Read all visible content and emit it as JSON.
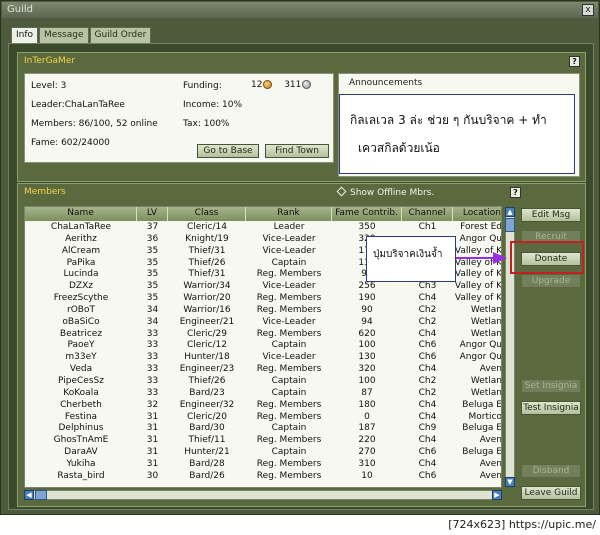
{
  "window": {
    "title": "Guild",
    "close_label": "x"
  },
  "tabs": [
    {
      "label": "Info"
    },
    {
      "label": "Message"
    },
    {
      "label": "Guild Order"
    }
  ],
  "guild": {
    "name": "InTerGaMer",
    "help_label": "?",
    "level": "Level: 3",
    "leader": "Leader:ChaLanTaRee",
    "members": "Members: 86/100, 52 online",
    "fame": "Fame: 602/24000",
    "funding_label": "Funding:",
    "funding_gold": "12",
    "funding_silver": "311",
    "income": "Income: 10%",
    "tax": "Tax: 100%",
    "go_to_base": "Go to Base",
    "find_town": "Find Town"
  },
  "announcements": {
    "title": "Announcements",
    "note_line1": "กิลเลเวล 3 ล่ะ ช่วย ๆ กันบริจาค + ทำ",
    "note_line2": "เควสกิลด้วยเน้อ"
  },
  "members_panel": {
    "title": "Members",
    "show_offline": "Show Offline Mbrs.",
    "help_label": "?",
    "columns": [
      "Name",
      "LV",
      "Class",
      "Rank",
      "Fame Contrib.",
      "Channel",
      "Location"
    ],
    "rows": [
      [
        "ChaLanTaRee",
        "37",
        "Cleric/14",
        "Leader",
        "350",
        "Ch1",
        "Forest Ed"
      ],
      [
        "Aerithz",
        "36",
        "Knight/19",
        "Vice-Leader",
        "320",
        "",
        "Angor Qu"
      ],
      [
        "AlCream",
        "35",
        "Thief/31",
        "Vice-Leader",
        "170",
        "",
        "Valley of K"
      ],
      [
        "PaPika",
        "35",
        "Thief/26",
        "Captain",
        "136",
        "",
        "Valley of K"
      ],
      [
        "Lucinda",
        "35",
        "Thief/31",
        "Reg. Members",
        "98",
        "",
        "Valley of K"
      ],
      [
        "DZXz",
        "35",
        "Warrior/34",
        "Vice-Leader",
        "256",
        "Ch3",
        "Valley of K"
      ],
      [
        "FreezScythe",
        "35",
        "Warrior/20",
        "Reg. Members",
        "190",
        "Ch4",
        "Valley of K"
      ],
      [
        "rOBoT",
        "34",
        "Warrior/16",
        "Reg. Members",
        "90",
        "Ch2",
        "Wetlan"
      ],
      [
        "oBaSiCo",
        "34",
        "Engineer/21",
        "Vice-Leader",
        "94",
        "Ch2",
        "Wetlan"
      ],
      [
        "Beatricez",
        "33",
        "Cleric/29",
        "Reg. Members",
        "620",
        "Ch4",
        "Wetlan"
      ],
      [
        "PaoeY",
        "33",
        "Cleric/12",
        "Captain",
        "100",
        "Ch6",
        "Angor Qu"
      ],
      [
        "m33eY",
        "33",
        "Hunter/18",
        "Vice-Leader",
        "130",
        "Ch6",
        "Angor Qu"
      ],
      [
        "Veda",
        "33",
        "Engineer/23",
        "Reg. Members",
        "320",
        "Ch4",
        "Aven"
      ],
      [
        "PipeCesSz",
        "33",
        "Thief/26",
        "Captain",
        "100",
        "Ch2",
        "Wetlan"
      ],
      [
        "KoKoala",
        "33",
        "Bard/23",
        "Captain",
        "87",
        "Ch2",
        "Wetlan"
      ],
      [
        "Cherbeth",
        "32",
        "Engineer/32",
        "Reg. Members",
        "180",
        "Ch4",
        "Beluga E"
      ],
      [
        "Festina",
        "31",
        "Cleric/20",
        "Reg. Members",
        "0",
        "Ch4",
        "Mortico"
      ],
      [
        "Delphinus",
        "31",
        "Bard/30",
        "Captain",
        "187",
        "Ch9",
        "Beluga E"
      ],
      [
        "GhosTnAmE",
        "31",
        "Thief/11",
        "Reg. Members",
        "220",
        "Ch4",
        "Aven"
      ],
      [
        "DaraAV",
        "31",
        "Hunter/21",
        "Captain",
        "270",
        "Ch6",
        "Beluga E"
      ],
      [
        "Yukiha",
        "31",
        "Bard/28",
        "Reg. Members",
        "310",
        "Ch4",
        "Aven"
      ],
      [
        "Rasta_bird",
        "30",
        "Bard/26",
        "Reg. Members",
        "10",
        "Ch6",
        "Aven"
      ]
    ],
    "buttons": {
      "edit_msg": "Edit Msg",
      "recruit": "Recruit",
      "donate": "Donate",
      "upgrade": "Upgrade",
      "set_insignia": "Set Insignia",
      "test_insignia": "Test Insignia",
      "disband": "Disband",
      "leave_guild": "Leave Guild"
    },
    "donate_note": "ปุ่มบริจาคเงินจ้ำ"
  },
  "watermark": "[724x623] https://upic.me/",
  "colors": {
    "panel_title": "#f5d24a",
    "highlight": "#c42020",
    "arrow": "#9a2de0"
  }
}
